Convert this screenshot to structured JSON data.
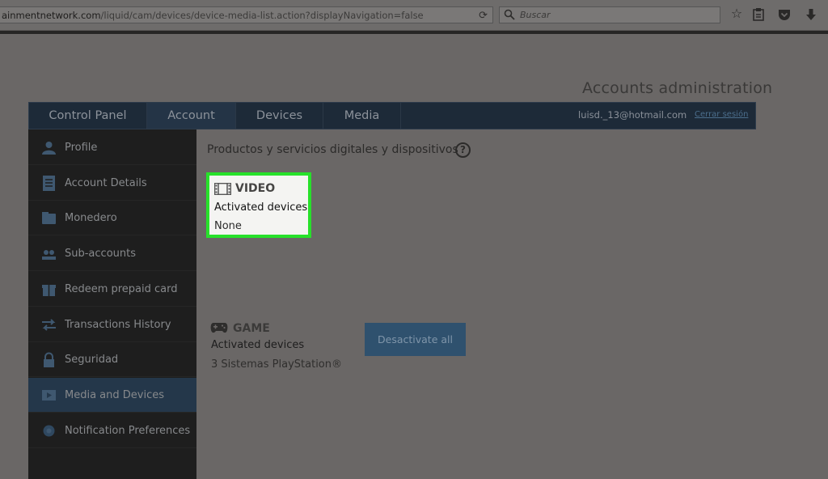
{
  "browser": {
    "url_host": "ainmentnetwork.com",
    "url_path": "/liquid/cam/devices/device-media-list.action?displayNavigation=false",
    "search_placeholder": "Buscar"
  },
  "page": {
    "title": "Accounts administration",
    "nav_tabs": [
      {
        "label": "Control Panel",
        "active": false
      },
      {
        "label": "Account",
        "active": true
      },
      {
        "label": "Devices",
        "active": false
      },
      {
        "label": "Media",
        "active": false
      }
    ],
    "user_email": "luisd._13@hotmail.com",
    "logout_label": "Cerrar sesión"
  },
  "sidebar": {
    "items": [
      {
        "label": "Profile",
        "icon": "person-icon"
      },
      {
        "label": "Account Details",
        "icon": "document-icon"
      },
      {
        "label": "Monedero",
        "icon": "wallet-icon"
      },
      {
        "label": "Sub-accounts",
        "icon": "people-icon"
      },
      {
        "label": "Redeem prepaid card",
        "icon": "gift-icon"
      },
      {
        "label": "Transactions History",
        "icon": "arrows-icon"
      },
      {
        "label": "Seguridad",
        "icon": "lock-icon"
      },
      {
        "label": "Media and Devices",
        "icon": "media-icon",
        "active": true
      },
      {
        "label": "Notification Preferences",
        "icon": "bell-icon"
      }
    ]
  },
  "main": {
    "section_title": "Productos y servicios digitales y dispositivos",
    "help_label": "?",
    "video": {
      "title": "VIDEO",
      "subtitle": "Activated devices",
      "value": "None"
    },
    "game": {
      "title": "GAME",
      "subtitle": "Activated devices",
      "value": "3 Sistemas PlayStation®"
    },
    "deactivate_label": "Desactivate all"
  },
  "colors": {
    "highlight": "#27e12a",
    "nav_bg": "#1d2a38",
    "sidebar_bg": "#1e1e1e",
    "sidebar_active": "#24374a",
    "button_bg": "#2f516e"
  }
}
